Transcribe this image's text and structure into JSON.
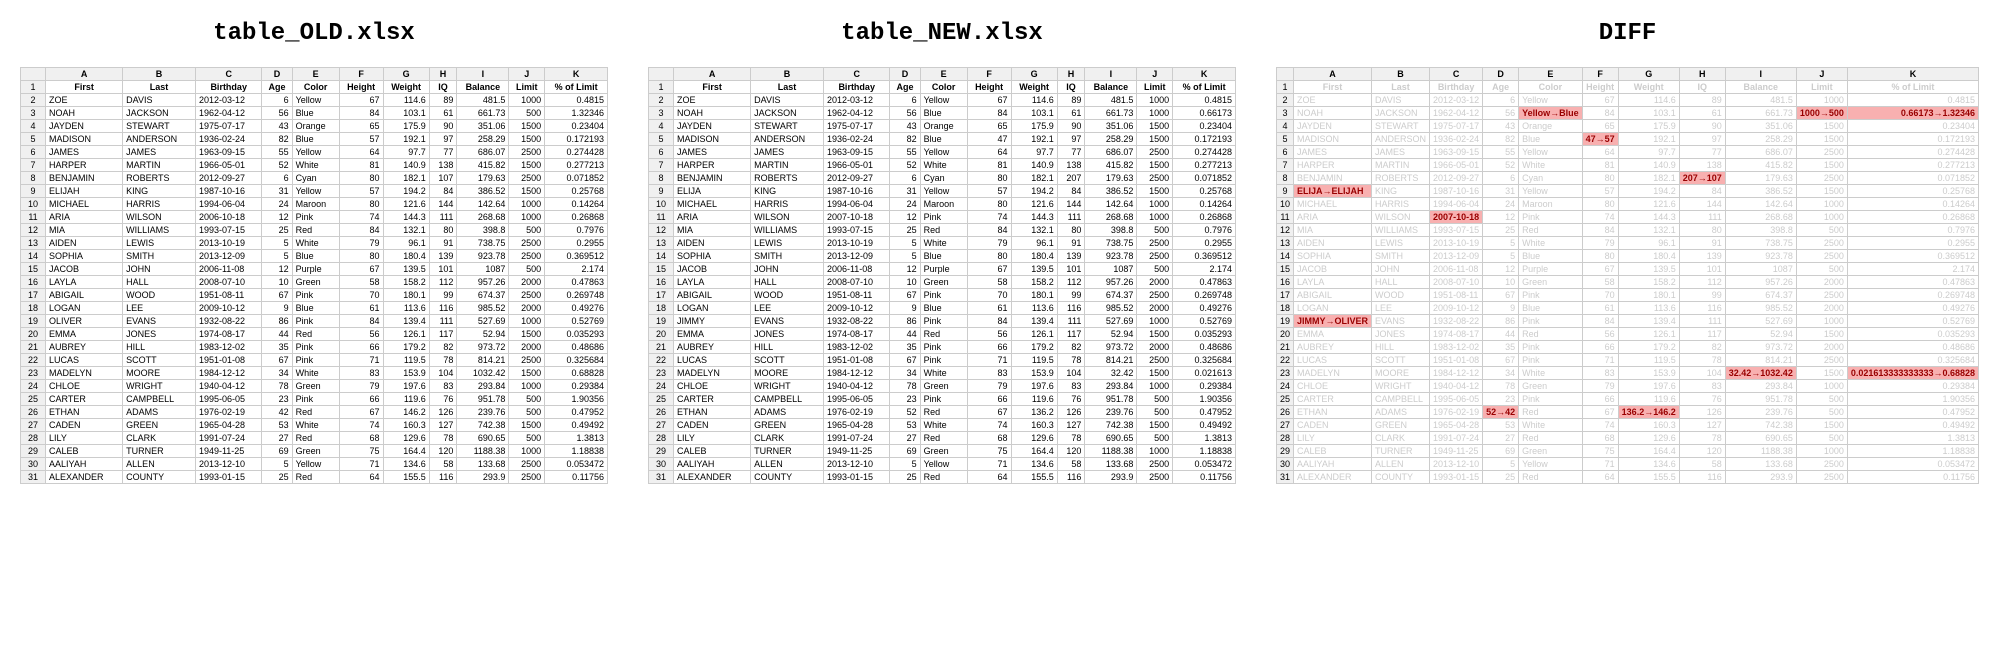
{
  "titles": {
    "old": "table_OLD.xlsx",
    "new": "table_NEW.xlsx",
    "diff": "DIFF"
  },
  "colLetters": [
    "A",
    "B",
    "C",
    "D",
    "E",
    "F",
    "G",
    "H",
    "I",
    "J",
    "K"
  ],
  "headers": [
    "First",
    "Last",
    "Birthday",
    "Age",
    "Color",
    "Height",
    "Weight",
    "IQ",
    "Balance",
    "Limit",
    "% of Limit"
  ],
  "old": [
    [
      "ZOE",
      "DAVIS",
      "2012-03-12",
      "6",
      "Yellow",
      "67",
      "114.6",
      "89",
      "481.5",
      "1000",
      "0.4815"
    ],
    [
      "NOAH",
      "JACKSON",
      "1962-04-12",
      "56",
      "Blue",
      "84",
      "103.1",
      "61",
      "661.73",
      "500",
      "1.32346"
    ],
    [
      "JAYDEN",
      "STEWART",
      "1975-07-17",
      "43",
      "Orange",
      "65",
      "175.9",
      "90",
      "351.06",
      "1500",
      "0.23404"
    ],
    [
      "MADISON",
      "ANDERSON",
      "1936-02-24",
      "82",
      "Blue",
      "57",
      "192.1",
      "97",
      "258.29",
      "1500",
      "0.172193"
    ],
    [
      "JAMES",
      "JAMES",
      "1963-09-15",
      "55",
      "Yellow",
      "64",
      "97.7",
      "77",
      "686.07",
      "2500",
      "0.274428"
    ],
    [
      "HARPER",
      "MARTIN",
      "1966-05-01",
      "52",
      "White",
      "81",
      "140.9",
      "138",
      "415.82",
      "1500",
      "0.277213"
    ],
    [
      "BENJAMIN",
      "ROBERTS",
      "2012-09-27",
      "6",
      "Cyan",
      "80",
      "182.1",
      "107",
      "179.63",
      "2500",
      "0.071852"
    ],
    [
      "ELIJAH",
      "KING",
      "1987-10-16",
      "31",
      "Yellow",
      "57",
      "194.2",
      "84",
      "386.52",
      "1500",
      "0.25768"
    ],
    [
      "MICHAEL",
      "HARRIS",
      "1994-06-04",
      "24",
      "Maroon",
      "80",
      "121.6",
      "144",
      "142.64",
      "1000",
      "0.14264"
    ],
    [
      "ARIA",
      "WILSON",
      "2006-10-18",
      "12",
      "Pink",
      "74",
      "144.3",
      "111",
      "268.68",
      "1000",
      "0.26868"
    ],
    [
      "MIA",
      "WILLIAMS",
      "1993-07-15",
      "25",
      "Red",
      "84",
      "132.1",
      "80",
      "398.8",
      "500",
      "0.7976"
    ],
    [
      "AIDEN",
      "LEWIS",
      "2013-10-19",
      "5",
      "White",
      "79",
      "96.1",
      "91",
      "738.75",
      "2500",
      "0.2955"
    ],
    [
      "SOPHIA",
      "SMITH",
      "2013-12-09",
      "5",
      "Blue",
      "80",
      "180.4",
      "139",
      "923.78",
      "2500",
      "0.369512"
    ],
    [
      "JACOB",
      "JOHN",
      "2006-11-08",
      "12",
      "Purple",
      "67",
      "139.5",
      "101",
      "1087",
      "500",
      "2.174"
    ],
    [
      "LAYLA",
      "HALL",
      "2008-07-10",
      "10",
      "Green",
      "58",
      "158.2",
      "112",
      "957.26",
      "2000",
      "0.47863"
    ],
    [
      "ABIGAIL",
      "WOOD",
      "1951-08-11",
      "67",
      "Pink",
      "70",
      "180.1",
      "99",
      "674.37",
      "2500",
      "0.269748"
    ],
    [
      "LOGAN",
      "LEE",
      "2009-10-12",
      "9",
      "Blue",
      "61",
      "113.6",
      "116",
      "985.52",
      "2000",
      "0.49276"
    ],
    [
      "OLIVER",
      "EVANS",
      "1932-08-22",
      "86",
      "Pink",
      "84",
      "139.4",
      "111",
      "527.69",
      "1000",
      "0.52769"
    ],
    [
      "EMMA",
      "JONES",
      "1974-08-17",
      "44",
      "Red",
      "56",
      "126.1",
      "117",
      "52.94",
      "1500",
      "0.035293"
    ],
    [
      "AUBREY",
      "HILL",
      "1983-12-02",
      "35",
      "Pink",
      "66",
      "179.2",
      "82",
      "973.72",
      "2000",
      "0.48686"
    ],
    [
      "LUCAS",
      "SCOTT",
      "1951-01-08",
      "67",
      "Pink",
      "71",
      "119.5",
      "78",
      "814.21",
      "2500",
      "0.325684"
    ],
    [
      "MADELYN",
      "MOORE",
      "1984-12-12",
      "34",
      "White",
      "83",
      "153.9",
      "104",
      "1032.42",
      "1500",
      "0.68828"
    ],
    [
      "CHLOE",
      "WRIGHT",
      "1940-04-12",
      "78",
      "Green",
      "79",
      "197.6",
      "83",
      "293.84",
      "1000",
      "0.29384"
    ],
    [
      "CARTER",
      "CAMPBELL",
      "1995-06-05",
      "23",
      "Pink",
      "66",
      "119.6",
      "76",
      "951.78",
      "500",
      "1.90356"
    ],
    [
      "ETHAN",
      "ADAMS",
      "1976-02-19",
      "42",
      "Red",
      "67",
      "146.2",
      "126",
      "239.76",
      "500",
      "0.47952"
    ],
    [
      "CADEN",
      "GREEN",
      "1965-04-28",
      "53",
      "White",
      "74",
      "160.3",
      "127",
      "742.38",
      "1500",
      "0.49492"
    ],
    [
      "LILY",
      "CLARK",
      "1991-07-24",
      "27",
      "Red",
      "68",
      "129.6",
      "78",
      "690.65",
      "500",
      "1.3813"
    ],
    [
      "CALEB",
      "TURNER",
      "1949-11-25",
      "69",
      "Green",
      "75",
      "164.4",
      "120",
      "1188.38",
      "1000",
      "1.18838"
    ],
    [
      "AALIYAH",
      "ALLEN",
      "2013-12-10",
      "5",
      "Yellow",
      "71",
      "134.6",
      "58",
      "133.68",
      "2500",
      "0.053472"
    ],
    [
      "ALEXANDER",
      "COUNTY",
      "1993-01-15",
      "25",
      "Red",
      "64",
      "155.5",
      "116",
      "293.9",
      "2500",
      "0.11756"
    ]
  ],
  "new": [
    [
      "ZOE",
      "DAVIS",
      "2012-03-12",
      "6",
      "Yellow",
      "67",
      "114.6",
      "89",
      "481.5",
      "1000",
      "0.4815"
    ],
    [
      "NOAH",
      "JACKSON",
      "1962-04-12",
      "56",
      "Blue",
      "84",
      "103.1",
      "61",
      "661.73",
      "1000",
      "0.66173"
    ],
    [
      "JAYDEN",
      "STEWART",
      "1975-07-17",
      "43",
      "Orange",
      "65",
      "175.9",
      "90",
      "351.06",
      "1500",
      "0.23404"
    ],
    [
      "MADISON",
      "ANDERSON",
      "1936-02-24",
      "82",
      "Blue",
      "47",
      "192.1",
      "97",
      "258.29",
      "1500",
      "0.172193"
    ],
    [
      "JAMES",
      "JAMES",
      "1963-09-15",
      "55",
      "Yellow",
      "64",
      "97.7",
      "77",
      "686.07",
      "2500",
      "0.274428"
    ],
    [
      "HARPER",
      "MARTIN",
      "1966-05-01",
      "52",
      "White",
      "81",
      "140.9",
      "138",
      "415.82",
      "1500",
      "0.277213"
    ],
    [
      "BENJAMIN",
      "ROBERTS",
      "2012-09-27",
      "6",
      "Cyan",
      "80",
      "182.1",
      "207",
      "179.63",
      "2500",
      "0.071852"
    ],
    [
      "ELIJA",
      "KING",
      "1987-10-16",
      "31",
      "Yellow",
      "57",
      "194.2",
      "84",
      "386.52",
      "1500",
      "0.25768"
    ],
    [
      "MICHAEL",
      "HARRIS",
      "1994-06-04",
      "24",
      "Maroon",
      "80",
      "121.6",
      "144",
      "142.64",
      "1000",
      "0.14264"
    ],
    [
      "ARIA",
      "WILSON",
      "2007-10-18",
      "12",
      "Pink",
      "74",
      "144.3",
      "111",
      "268.68",
      "1000",
      "0.26868"
    ],
    [
      "MIA",
      "WILLIAMS",
      "1993-07-15",
      "25",
      "Red",
      "84",
      "132.1",
      "80",
      "398.8",
      "500",
      "0.7976"
    ],
    [
      "AIDEN",
      "LEWIS",
      "2013-10-19",
      "5",
      "White",
      "79",
      "96.1",
      "91",
      "738.75",
      "2500",
      "0.2955"
    ],
    [
      "SOPHIA",
      "SMITH",
      "2013-12-09",
      "5",
      "Blue",
      "80",
      "180.4",
      "139",
      "923.78",
      "2500",
      "0.369512"
    ],
    [
      "JACOB",
      "JOHN",
      "2006-11-08",
      "12",
      "Purple",
      "67",
      "139.5",
      "101",
      "1087",
      "500",
      "2.174"
    ],
    [
      "LAYLA",
      "HALL",
      "2008-07-10",
      "10",
      "Green",
      "58",
      "158.2",
      "112",
      "957.26",
      "2000",
      "0.47863"
    ],
    [
      "ABIGAIL",
      "WOOD",
      "1951-08-11",
      "67",
      "Pink",
      "70",
      "180.1",
      "99",
      "674.37",
      "2500",
      "0.269748"
    ],
    [
      "LOGAN",
      "LEE",
      "2009-10-12",
      "9",
      "Blue",
      "61",
      "113.6",
      "116",
      "985.52",
      "2000",
      "0.49276"
    ],
    [
      "JIMMY",
      "EVANS",
      "1932-08-22",
      "86",
      "Pink",
      "84",
      "139.4",
      "111",
      "527.69",
      "1000",
      "0.52769"
    ],
    [
      "EMMA",
      "JONES",
      "1974-08-17",
      "44",
      "Red",
      "56",
      "126.1",
      "117",
      "52.94",
      "1500",
      "0.035293"
    ],
    [
      "AUBREY",
      "HILL",
      "1983-12-02",
      "35",
      "Pink",
      "66",
      "179.2",
      "82",
      "973.72",
      "2000",
      "0.48686"
    ],
    [
      "LUCAS",
      "SCOTT",
      "1951-01-08",
      "67",
      "Pink",
      "71",
      "119.5",
      "78",
      "814.21",
      "2500",
      "0.325684"
    ],
    [
      "MADELYN",
      "MOORE",
      "1984-12-12",
      "34",
      "White",
      "83",
      "153.9",
      "104",
      "32.42",
      "1500",
      "0.021613"
    ],
    [
      "CHLOE",
      "WRIGHT",
      "1940-04-12",
      "78",
      "Green",
      "79",
      "197.6",
      "83",
      "293.84",
      "1000",
      "0.29384"
    ],
    [
      "CARTER",
      "CAMPBELL",
      "1995-06-05",
      "23",
      "Pink",
      "66",
      "119.6",
      "76",
      "951.78",
      "500",
      "1.90356"
    ],
    [
      "ETHAN",
      "ADAMS",
      "1976-02-19",
      "52",
      "Red",
      "67",
      "136.2",
      "126",
      "239.76",
      "500",
      "0.47952"
    ],
    [
      "CADEN",
      "GREEN",
      "1965-04-28",
      "53",
      "White",
      "74",
      "160.3",
      "127",
      "742.38",
      "1500",
      "0.49492"
    ],
    [
      "LILY",
      "CLARK",
      "1991-07-24",
      "27",
      "Red",
      "68",
      "129.6",
      "78",
      "690.65",
      "500",
      "1.3813"
    ],
    [
      "CALEB",
      "TURNER",
      "1949-11-25",
      "69",
      "Green",
      "75",
      "164.4",
      "120",
      "1188.38",
      "1000",
      "1.18838"
    ],
    [
      "AALIYAH",
      "ALLEN",
      "2013-12-10",
      "5",
      "Yellow",
      "71",
      "134.6",
      "58",
      "133.68",
      "2500",
      "0.053472"
    ],
    [
      "ALEXANDER",
      "COUNTY",
      "1993-01-15",
      "25",
      "Red",
      "64",
      "155.5",
      "116",
      "293.9",
      "2500",
      "0.11756"
    ]
  ],
  "diff": {
    "3": {
      "4": "Yellow→Blue",
      "9": "1000→500",
      "10": "0.66173→1.32346"
    },
    "5": {
      "5": "47→57"
    },
    "8": {
      "7": "207→107"
    },
    "9": {
      "0": "ELIJA→ELIJAH"
    },
    "11": {
      "2": "2007-10-18"
    },
    "19": {
      "0": "JIMMY→OLIVER"
    },
    "23": {
      "8": "32.42→1032.42",
      "10": "0.021613333333333→0.68828"
    },
    "26": {
      "3": "52→42",
      "6": "136.2→146.2"
    }
  },
  "leftCols": [
    0,
    1,
    2,
    4
  ]
}
